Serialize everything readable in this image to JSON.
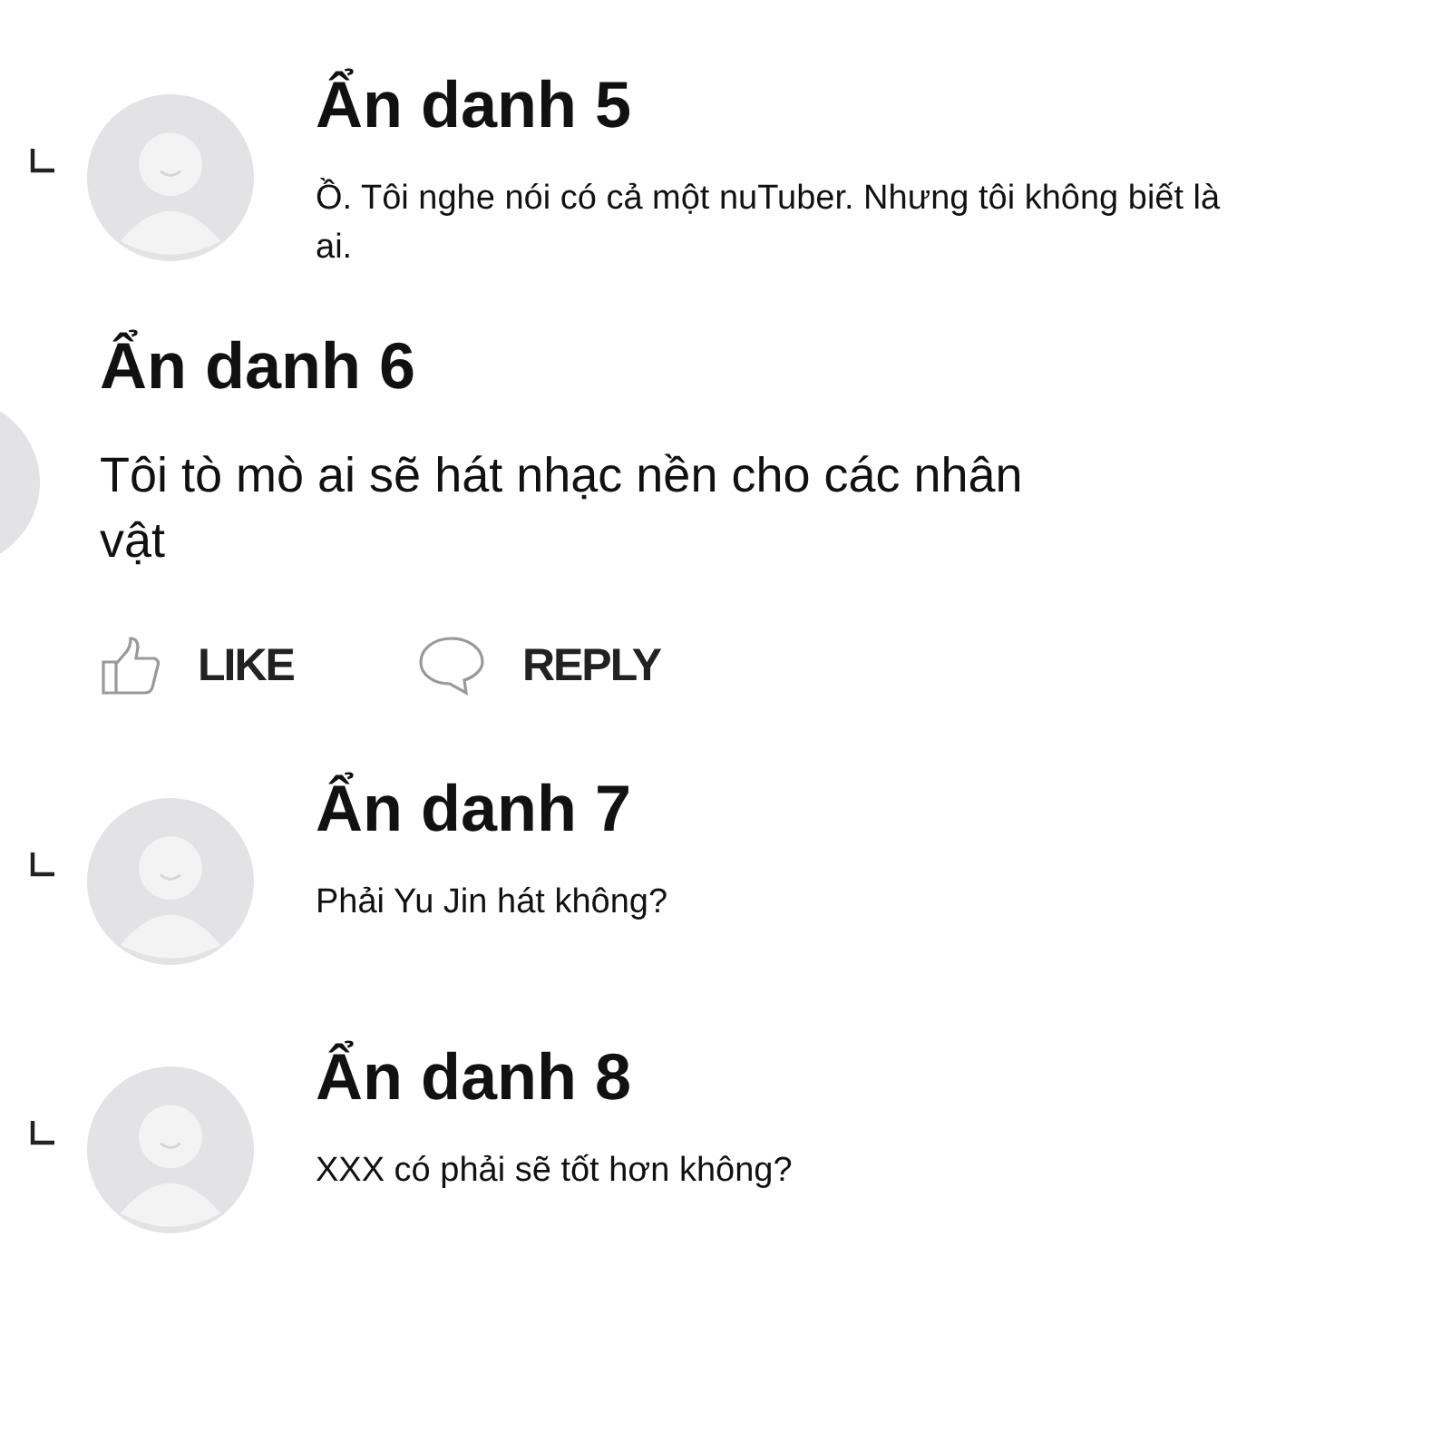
{
  "comments": [
    {
      "kind": "reply",
      "author": "Ẩn danh 5",
      "text": "Ồ. Tôi nghe nói có cả một nuTuber. Nhưng tôi không biết là ai."
    },
    {
      "kind": "top",
      "author": "Ẩn danh 6",
      "text": "Tôi tò mò ai sẽ hát nhạc nền cho các nhân vật",
      "actions": [
        {
          "kind": "like",
          "label": "LIKE"
        },
        {
          "kind": "reply",
          "label": "REPLY"
        }
      ]
    },
    {
      "kind": "reply",
      "author": "Ẩn danh 7",
      "text": "Phải Yu Jin hát không?"
    },
    {
      "kind": "reply",
      "author": "Ẩn danh 8",
      "text": "XXX có phải sẽ tốt hơn không?"
    }
  ]
}
